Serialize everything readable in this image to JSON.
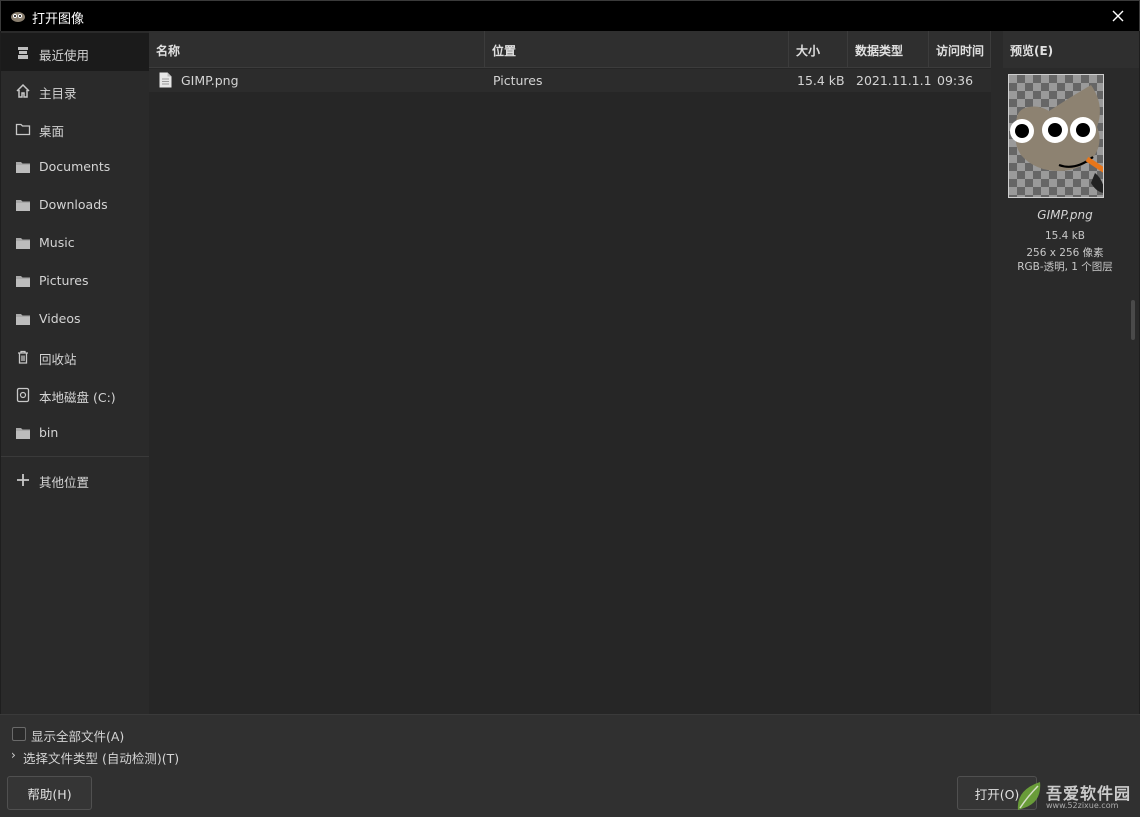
{
  "window": {
    "title": "打开图像",
    "close_label": "✕"
  },
  "sidebar": {
    "items": [
      {
        "label": "最近使用",
        "icon": "recent-icon"
      },
      {
        "label": "主目录",
        "icon": "home-icon"
      },
      {
        "label": "桌面",
        "icon": "desktop-folder-icon"
      },
      {
        "label": "Documents",
        "icon": "folder-icon"
      },
      {
        "label": "Downloads",
        "icon": "folder-icon"
      },
      {
        "label": "Music",
        "icon": "folder-icon"
      },
      {
        "label": "Pictures",
        "icon": "folder-icon"
      },
      {
        "label": "Videos",
        "icon": "folder-icon"
      },
      {
        "label": "回收站",
        "icon": "trash-icon"
      },
      {
        "label": "本地磁盘 (C:)",
        "icon": "drive-icon"
      },
      {
        "label": "bin",
        "icon": "folder-icon"
      }
    ],
    "other_locations": "其他位置"
  },
  "file_list": {
    "columns": [
      "名称",
      "位置",
      "大小",
      "数据类型",
      "访问时间"
    ],
    "rows": [
      {
        "name": "GIMP.png",
        "location": "Pictures",
        "size": "15.4 kB",
        "type": "2021.11.1.1",
        "time": "09:36"
      }
    ]
  },
  "preview": {
    "header": "预览(E)",
    "filename": "GIMP.png",
    "size": "15.4 kB",
    "dimensions": "256 x 256 像素",
    "mode": "RGB-透明, 1 个图层"
  },
  "bottom": {
    "show_all_files": "显示全部文件(A)",
    "select_file_type": "选择文件类型 (自动检测)(T)",
    "help_button": "帮助(H)",
    "open_button": "打开(O)"
  },
  "watermark": {
    "text": "吾爱软件园",
    "url": "www.52zixue.com"
  }
}
